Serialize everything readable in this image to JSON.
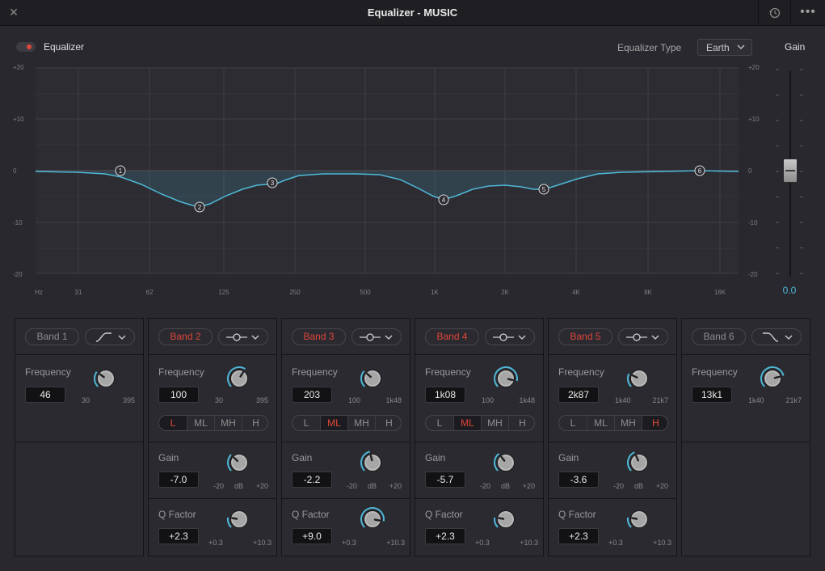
{
  "window": {
    "title": "Equalizer - MUSIC",
    "close_glyph": "✕",
    "more_glyph": "•••"
  },
  "header": {
    "equalizer_label": "Equalizer",
    "equalizer_enabled": true,
    "eq_type_label": "Equalizer Type",
    "eq_type_value": "Earth",
    "gain_label": "Gain"
  },
  "graph": {
    "db_ticks": [
      "+20",
      "+10",
      "0",
      "-10",
      "-20"
    ],
    "freq_ticks": [
      "Hz",
      "31",
      "62",
      "125",
      "250",
      "500",
      "1K",
      "2K",
      "4K",
      "8K",
      "16K"
    ],
    "nodes": [
      "1",
      "2",
      "3",
      "4",
      "5",
      "6"
    ]
  },
  "master_gain": {
    "value": "0.0"
  },
  "segment_labels": [
    "L",
    "ML",
    "MH",
    "H"
  ],
  "labels": {
    "frequency": "Frequency",
    "gain": "Gain",
    "q_factor": "Q Factor",
    "db_unit": "dB"
  },
  "bands": [
    {
      "name": "Band 1",
      "active": false,
      "shape": "low-cut-icon",
      "freq": "46",
      "freq_min": "30",
      "freq_max": "395",
      "freq_knob": 0.3
    },
    {
      "name": "Band 2",
      "active": true,
      "shape": "bell-icon",
      "freq": "100",
      "freq_min": "30",
      "freq_max": "395",
      "freq_knob": 0.62,
      "range": "L",
      "gain": "-7.0",
      "gain_min": "-20",
      "gain_max": "+20",
      "gain_knob": 0.33,
      "q": "+2.3",
      "q_min": "+0.3",
      "q_max": "+10.3",
      "q_knob": 0.2
    },
    {
      "name": "Band 3",
      "active": true,
      "shape": "bell-icon",
      "freq": "203",
      "freq_min": "100",
      "freq_max": "1k48",
      "freq_knob": 0.32,
      "range": "ML",
      "gain": "-2.2",
      "gain_min": "-20",
      "gain_max": "+20",
      "gain_knob": 0.45,
      "q": "+9.0",
      "q_min": "+0.3",
      "q_max": "+10.3",
      "q_knob": 0.87
    },
    {
      "name": "Band 4",
      "active": true,
      "shape": "bell-icon",
      "freq": "1k08",
      "freq_min": "100",
      "freq_max": "1k48",
      "freq_knob": 0.88,
      "range": "ML",
      "gain": "-5.7",
      "gain_min": "-20",
      "gain_max": "+20",
      "gain_knob": 0.36,
      "q": "+2.3",
      "q_min": "+0.3",
      "q_max": "+10.3",
      "q_knob": 0.2
    },
    {
      "name": "Band 5",
      "active": true,
      "shape": "bell-icon",
      "freq": "2k87",
      "freq_min": "1k40",
      "freq_max": "21k7",
      "freq_knob": 0.26,
      "range": "H",
      "gain": "-3.6",
      "gain_min": "-20",
      "gain_max": "+20",
      "gain_knob": 0.41,
      "q": "+2.3",
      "q_min": "+0.3",
      "q_max": "+10.3",
      "q_knob": 0.2
    },
    {
      "name": "Band 6",
      "active": false,
      "shape": "high-cut-icon",
      "freq": "13k1",
      "freq_min": "1k40",
      "freq_max": "21k7",
      "freq_knob": 0.78
    }
  ],
  "colors": {
    "accent": "#4fb8d8",
    "active": "#e0463a",
    "background": "#28282e"
  }
}
